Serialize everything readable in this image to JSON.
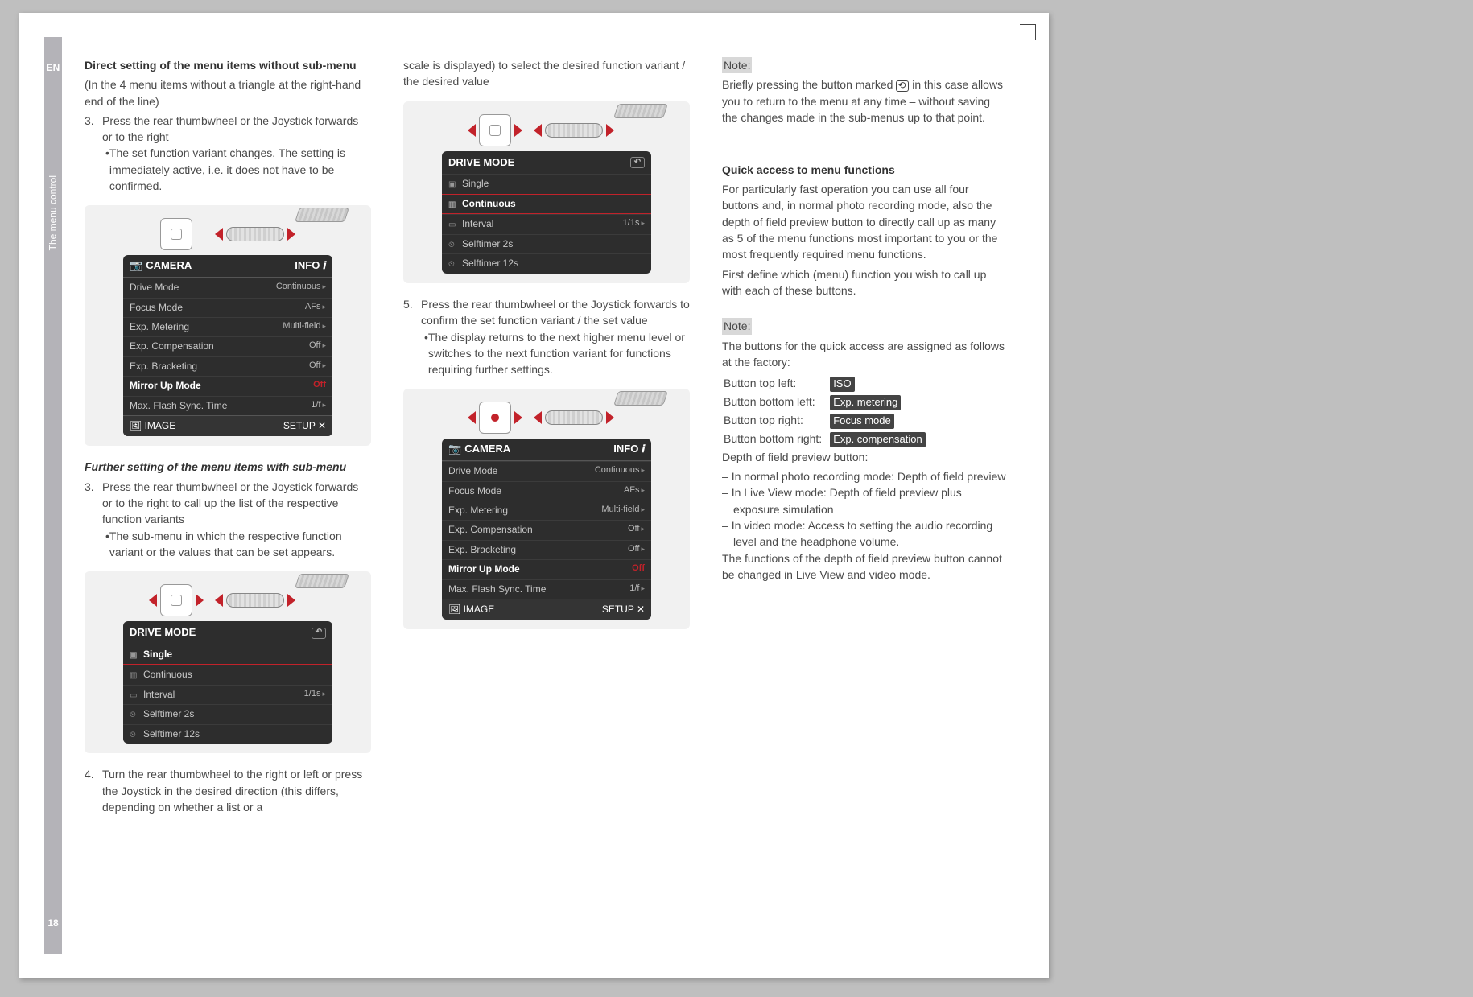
{
  "rail": {
    "lang": "EN",
    "title": "The menu control",
    "page": "18"
  },
  "col1": {
    "h1": "Direct setting of the menu items without sub-menu",
    "sub1": "(In the 4 menu items without a triangle at the right-hand end of the line)",
    "li3_n": "3.",
    "li3": "Press the rear thumbwheel or the Joystick forwards or to the right",
    "li3b": "The set function variant changes. The setting is immediately active, i.e. it does not have to be confirmed.",
    "h2": "Further setting of the menu items with sub-menu",
    "li3b_n": "3.",
    "li3b2": "Press the rear thumbwheel or the Joystick forwards or to the right to call up the list of the respective function variants",
    "li3b2b": "The sub-menu in which the respective function variant or the values that can be set appears.",
    "li4_n": "4.",
    "li4": "Turn the rear thumbwheel to the right or left or press the Joystick in the desired direction (this differs, depending on whether a list or a"
  },
  "camMenu": {
    "hdr_l": "CAMERA",
    "hdr_r": "INFO",
    "r1l": "Drive Mode",
    "r1v": "Continuous",
    "r2l": "Focus Mode",
    "r2v": "AFs",
    "r3l": "Exp. Metering",
    "r3v": "Multi-field",
    "r4l": "Exp. Compensation",
    "r4v": "Off",
    "r5l": "Exp. Bracketing",
    "r5v": "Off",
    "r6l": "Mirror Up Mode",
    "r6v": "Off",
    "r7l": "Max. Flash Sync. Time",
    "r7v": "1/f",
    "ftr_l": "IMAGE",
    "ftr_r": "SETUP"
  },
  "driveMenu": {
    "title": "DRIVE MODE",
    "o1": "Single",
    "o2": "Continuous",
    "o3": "Interval",
    "o3v": "1/1s",
    "o4": "Selftimer 2s",
    "o5": "Selftimer 12s"
  },
  "col2": {
    "top": "scale is displayed) to select the desired function variant / the desired value",
    "li5_n": "5.",
    "li5": "Press the rear thumbwheel or the Joystick forwards to confirm the set function variant / the set value",
    "li5b": "The display returns to the next higher menu level or switches to the next function variant for functions requiring further settings."
  },
  "col3": {
    "note": "Note:",
    "note1a": "Briefly pressing the button marked ",
    "note1b": " in this case allows you to return to the menu at any time – without saving the changes made in the sub-menus up to that point.",
    "qh": "Quick access to menu functions",
    "qp1": "For particularly fast operation you can use all four buttons and, in normal photo recording mode, also the depth of field preview button to directly call up as many as 5 of the menu functions most important to you or the most frequently required menu functions.",
    "qp2": "First define which (menu) function you wish to call up with each of these buttons.",
    "n2": "Note:",
    "n2p": "The buttons for the quick access are assigned as follows at the factory:",
    "a1l": "Button top left:",
    "a1v": "ISO",
    "a2l": "Button bottom left:",
    "a2v": "Exp. metering",
    "a3l": "Button top right:",
    "a3v": "Focus mode",
    "a4l": "Button bottom right:",
    "a4v": "Exp. compensation",
    "dop": "Depth of field preview button:",
    "d1": "In normal photo recording mode: Depth of field preview",
    "d2": "In Live View mode: Depth of field preview plus exposure simulation",
    "d3": "In video mode: Access to setting the audio recording level and the headphone volume.",
    "dlast": "The functions of the depth of field preview button cannot be changed in Live View and video mode."
  }
}
